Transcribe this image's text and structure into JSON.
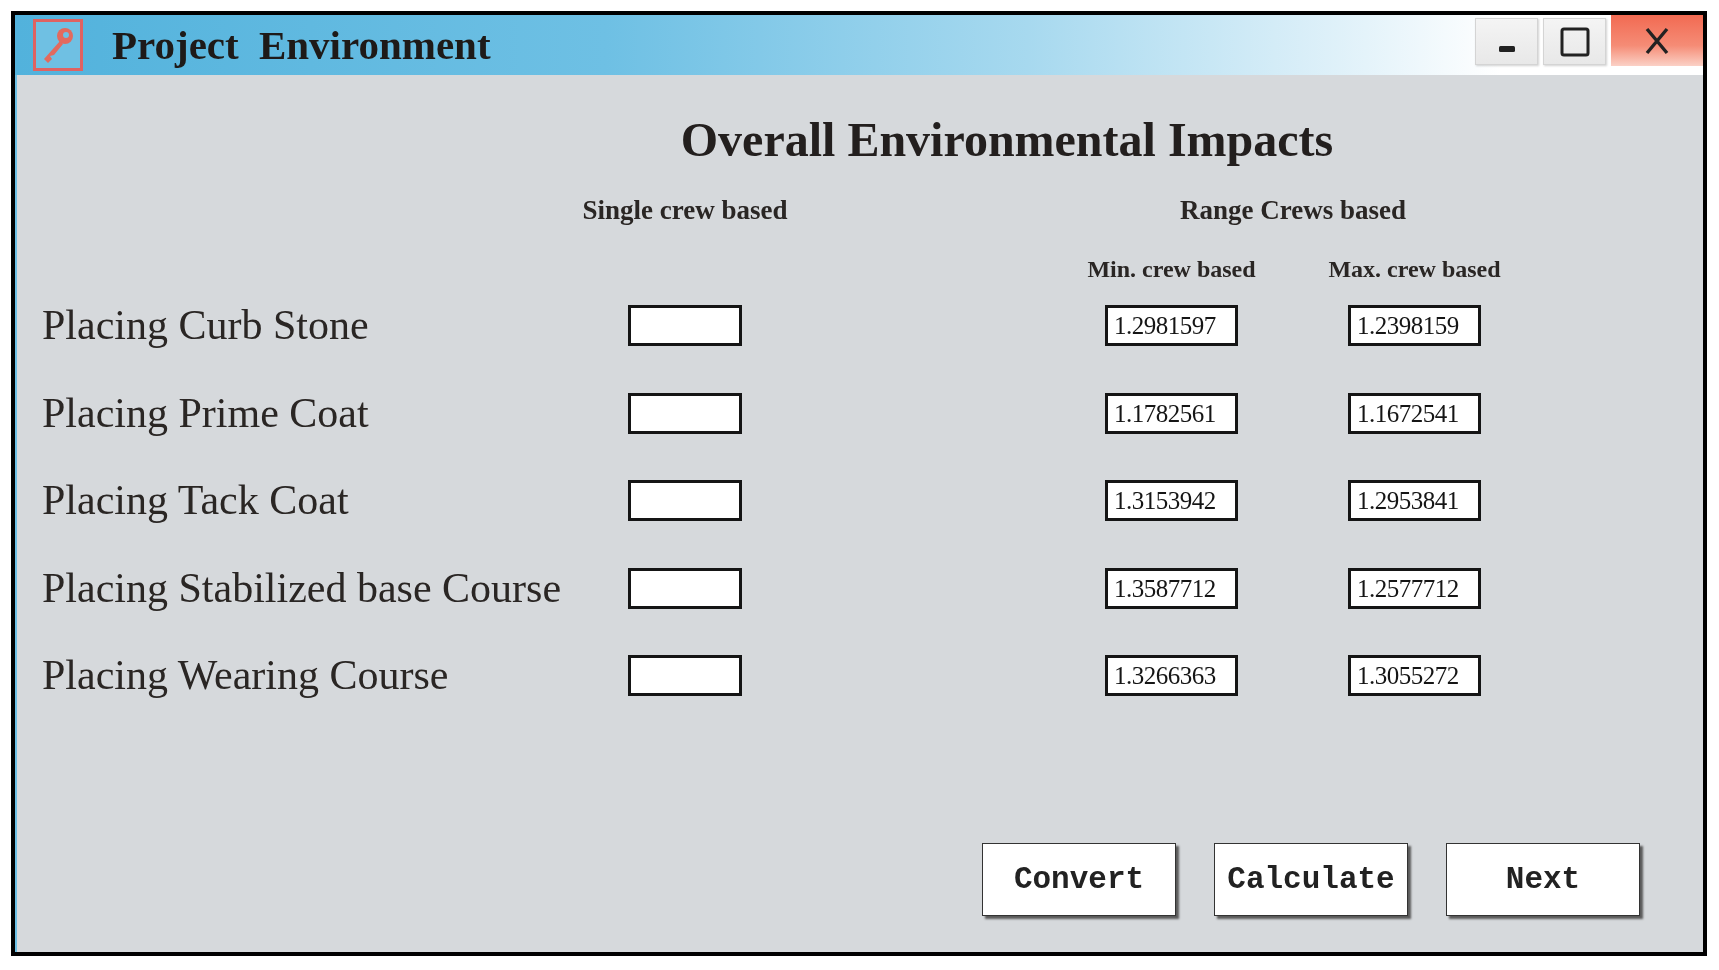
{
  "window": {
    "title": "Project Environment"
  },
  "heading": "Overall Environmental Impacts",
  "column_headers": {
    "single_crew": "Single crew based",
    "range_crews": "Range Crews based",
    "min_crew": "Min. crew based",
    "max_crew": "Max. crew based"
  },
  "rows": [
    {
      "label": "Placing Curb Stone",
      "min_crew": "1.2981597",
      "max_crew": "1.2398159"
    },
    {
      "label": "Placing Prime Coat",
      "min_crew": "1.1782561",
      "max_crew": "1.1672541"
    },
    {
      "label": "Placing Tack Coat",
      "min_crew": "1.3153942",
      "max_crew": "1.2953841"
    },
    {
      "label": "Placing Stabilized base Course",
      "min_crew": "1.3587712",
      "max_crew": "1.2577712"
    },
    {
      "label": "Placing Wearing Course",
      "min_crew": "1.3266363",
      "max_crew": "1.3055272"
    }
  ],
  "buttons": [
    "Convert",
    "Calculate",
    "Next"
  ]
}
